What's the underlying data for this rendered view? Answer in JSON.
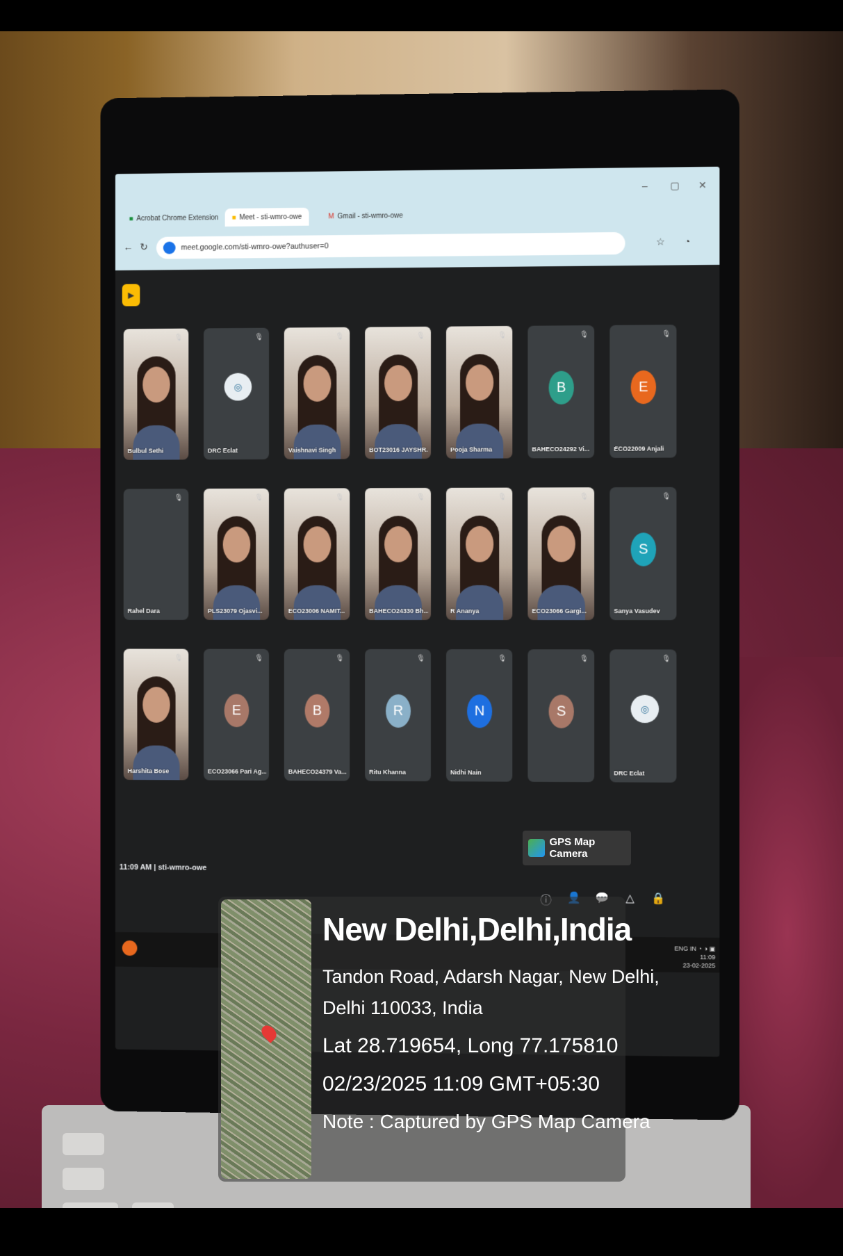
{
  "browser": {
    "tabs": [
      "Acrobat Chrome Extension",
      "Meet - sti-wmro-owe",
      "Gmail - sti-wmro-owe"
    ],
    "url": "meet.google.com/sti-wmro-owe?authuser=0",
    "window_controls": [
      "–",
      "▢",
      "✕"
    ]
  },
  "meet": {
    "participants": [
      {
        "name": "Bulbul Sethi",
        "kind": "video"
      },
      {
        "name": "DRC Eclat",
        "kind": "logo"
      },
      {
        "name": "Vaishnavi Singh",
        "kind": "video"
      },
      {
        "name": "BOT23016 JAYSHR...",
        "kind": "video"
      },
      {
        "name": "Pooja Sharma",
        "kind": "video"
      },
      {
        "name": "BAHECO24292 Vi...",
        "kind": "avatar",
        "initial": "B",
        "color": "#2e9e8a"
      },
      {
        "name": "ECO22009 Anjali",
        "kind": "avatar",
        "initial": "E",
        "color": "#e8681e"
      },
      {
        "name": "Rahel Dara",
        "kind": "blank"
      },
      {
        "name": "PLS23079 Ojasvi...",
        "kind": "video"
      },
      {
        "name": "ECO23006 NAMIT...",
        "kind": "video"
      },
      {
        "name": "BAHECO24330 Bh...",
        "kind": "video"
      },
      {
        "name": "R Ananya",
        "kind": "video"
      },
      {
        "name": "ECO23066 Gargi...",
        "kind": "video"
      },
      {
        "name": "Sanya Vasudev",
        "kind": "avatar",
        "initial": "S",
        "color": "#1fa3b8"
      },
      {
        "name": "Harshita Bose",
        "kind": "video"
      },
      {
        "name": "ECO23066 Pari Ag...",
        "kind": "avatar",
        "initial": "E",
        "color": "#a87868"
      },
      {
        "name": "BAHECO24379 Va...",
        "kind": "avatar",
        "initial": "B",
        "color": "#b07a68"
      },
      {
        "name": "Ritu Khanna",
        "kind": "avatar",
        "initial": "R",
        "color": "#8ab0c8"
      },
      {
        "name": "Nidhi Nain",
        "kind": "avatar",
        "initial": "N",
        "color": "#1e6fe0"
      },
      {
        "name": "",
        "kind": "avatar",
        "initial": "S",
        "color": "#a87868"
      },
      {
        "name": "DRC Eclat",
        "kind": "logo"
      }
    ],
    "footer_time": "11:09 AM",
    "meeting_code": "sti-wmro-owe"
  },
  "taskbar": {
    "language": "ENG IN",
    "time": "11:09",
    "date": "23-02-2025"
  },
  "gps": {
    "tag": "GPS Map Camera",
    "city": "New Delhi,Delhi,India",
    "address_line1": "Tandon Road, Adarsh Nagar, New Delhi,",
    "address_line2": "Delhi 110033, India",
    "coords": "Lat 28.719654, Long 77.175810",
    "datetime": "02/23/2025 11:09 GMT+05:30",
    "note": "Note : Captured by GPS Map Camera"
  }
}
